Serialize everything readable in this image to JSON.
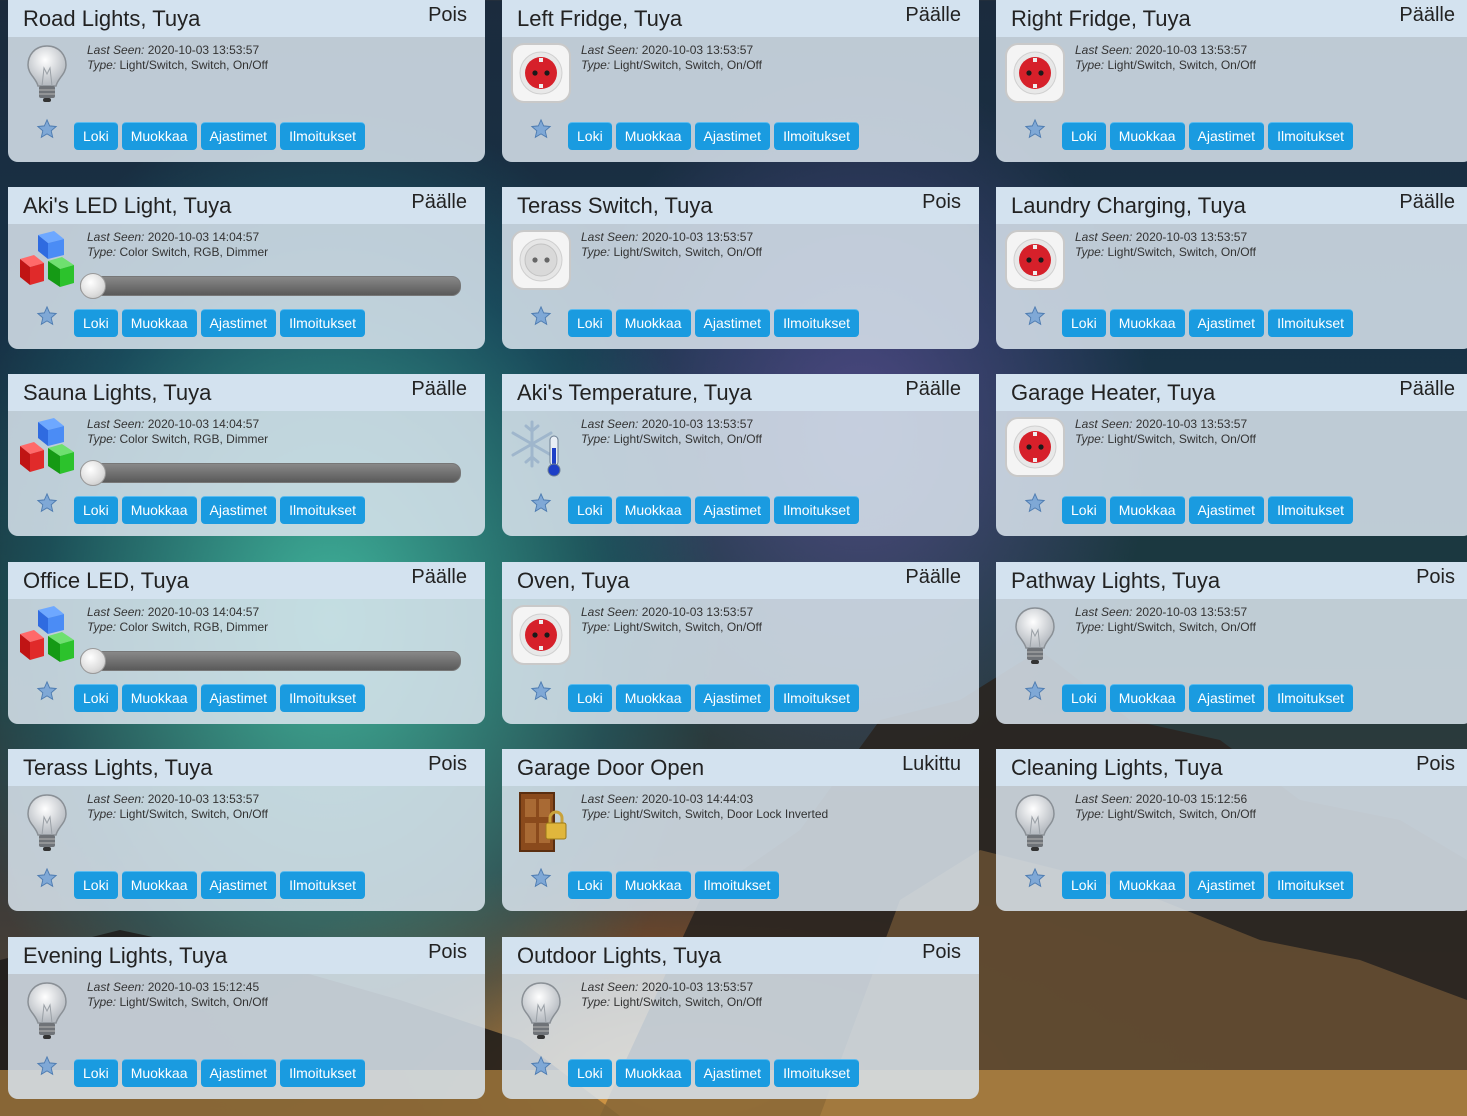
{
  "labels": {
    "last_seen": "Last Seen:",
    "type": "Type:"
  },
  "buttons": {
    "log": "Loki",
    "edit": "Muokkaa",
    "timers": "Ajastimet",
    "notifications": "Ilmoitukset"
  },
  "devices": [
    {
      "name": "Road Lights, Tuya",
      "status": "Pois",
      "last_seen": "2020-10-03 13:53:57",
      "type": "Light/Switch, Switch, On/Off",
      "icon": "lightbulb-icon"
    },
    {
      "name": "Left Fridge, Tuya",
      "status": "Päälle",
      "last_seen": "2020-10-03 13:53:57",
      "type": "Light/Switch, Switch, On/Off",
      "icon": "power-socket-on-icon"
    },
    {
      "name": "Right Fridge, Tuya",
      "status": "Päälle",
      "last_seen": "2020-10-03 13:53:57",
      "type": "Light/Switch, Switch, On/Off",
      "icon": "power-socket-on-icon"
    },
    {
      "name": "Aki's LED Light, Tuya",
      "status": "Päälle",
      "last_seen": "2020-10-03 14:04:57",
      "type": "Color Switch, RGB, Dimmer",
      "icon": "rgb-cubes-icon",
      "dimmer_level": 0
    },
    {
      "name": "Terass Switch, Tuya",
      "status": "Pois",
      "last_seen": "2020-10-03 13:53:57",
      "type": "Light/Switch, Switch, On/Off",
      "icon": "power-socket-off-icon"
    },
    {
      "name": "Laundry Charging, Tuya",
      "status": "Päälle",
      "last_seen": "2020-10-03 13:53:57",
      "type": "Light/Switch, Switch, On/Off",
      "icon": "power-socket-on-icon"
    },
    {
      "name": "Sauna Lights, Tuya",
      "status": "Päälle",
      "last_seen": "2020-10-03 14:04:57",
      "type": "Color Switch, RGB, Dimmer",
      "icon": "rgb-cubes-icon",
      "dimmer_level": 0
    },
    {
      "name": "Aki's Temperature, Tuya",
      "status": "Päälle",
      "last_seen": "2020-10-03 13:53:57",
      "type": "Light/Switch, Switch, On/Off",
      "icon": "snowflake-thermometer-icon"
    },
    {
      "name": "Garage Heater, Tuya",
      "status": "Päälle",
      "last_seen": "2020-10-03 13:53:57",
      "type": "Light/Switch, Switch, On/Off",
      "icon": "power-socket-on-icon"
    },
    {
      "name": "Office LED, Tuya",
      "status": "Päälle",
      "last_seen": "2020-10-03 14:04:57",
      "type": "Color Switch, RGB, Dimmer",
      "icon": "rgb-cubes-icon",
      "dimmer_level": 0
    },
    {
      "name": "Oven, Tuya",
      "status": "Päälle",
      "last_seen": "2020-10-03 13:53:57",
      "type": "Light/Switch, Switch, On/Off",
      "icon": "power-socket-on-icon"
    },
    {
      "name": "Pathway Lights, Tuya",
      "status": "Pois",
      "last_seen": "2020-10-03 13:53:57",
      "type": "Light/Switch, Switch, On/Off",
      "icon": "lightbulb-icon"
    },
    {
      "name": "Terass Lights, Tuya",
      "status": "Pois",
      "last_seen": "2020-10-03 13:53:57",
      "type": "Light/Switch, Switch, On/Off",
      "icon": "lightbulb-icon"
    },
    {
      "name": "Garage Door Open",
      "status": "Lukittu",
      "last_seen": "2020-10-03 14:44:03",
      "type": "Light/Switch, Switch, Door Lock Inverted",
      "icon": "door-lock-icon",
      "no_timers": true
    },
    {
      "name": "Cleaning Lights, Tuya",
      "status": "Pois",
      "last_seen": "2020-10-03 15:12:56",
      "type": "Light/Switch, Switch, On/Off",
      "icon": "lightbulb-icon"
    },
    {
      "name": "Evening Lights, Tuya",
      "status": "Pois",
      "last_seen": "2020-10-03 15:12:45",
      "type": "Light/Switch, Switch, On/Off",
      "icon": "lightbulb-icon"
    },
    {
      "name": "Outdoor Lights, Tuya",
      "status": "Pois",
      "last_seen": "2020-10-03 13:53:57",
      "type": "Light/Switch, Switch, On/Off",
      "icon": "lightbulb-icon"
    }
  ]
}
